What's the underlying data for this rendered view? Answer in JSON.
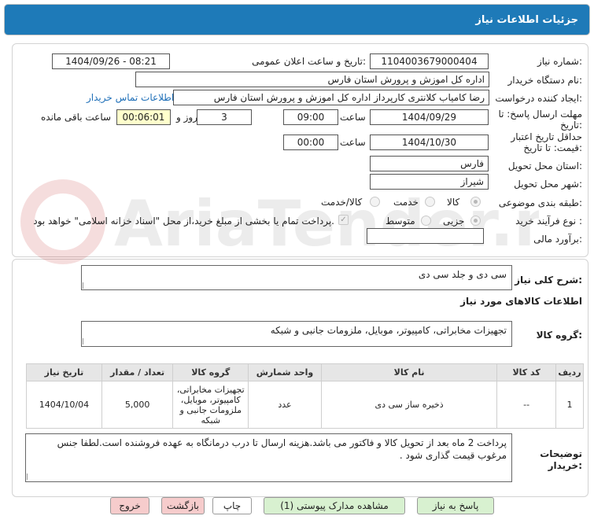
{
  "title": "جزئیات اطلاعات نیاز",
  "fields": {
    "need_number_label": "شماره نیاز:",
    "need_number": "1104003679000404",
    "announce_label": "تاریخ و ساعت اعلان عمومی:",
    "announce_value": "1404/09/26 - 08:21",
    "buyer_label": "نام دستگاه خریدار:",
    "buyer_value": "اداره کل اموزش و پرورش استان فارس",
    "creator_label": "ایجاد کننده درخواست:",
    "creator_value": "رضا کامیاب کلانتری کارپرداز اداره کل اموزش و پرورش استان فارس",
    "contact_link": "اطلاعات تماس خریدار",
    "deadline_label_1": "مهلت ارسال پاسخ: تا",
    "deadline_label_2": "تاریخ:",
    "deadline_date": "1404/09/29",
    "time_label": "ساعت",
    "deadline_time": "09:00",
    "days_value": "3",
    "days_label": "روز و",
    "remaining_value": "00:06:01",
    "remaining_label": "ساعت باقی مانده",
    "validity_label_1": "حداقل تاریخ اعتبار",
    "validity_label_2": "قیمت: تا تاریخ:",
    "validity_date": "1404/10/30",
    "validity_time": "00:00",
    "province_label": "استان محل تحویل:",
    "province_value": "فارس",
    "city_label": "شهر محل تحویل:",
    "city_value": "شیراز",
    "category_label": "طبقه بندی موضوعی:",
    "category_options": [
      "کالا",
      "خدمت",
      "کالا/خدمت"
    ],
    "process_label": "نوع فرآیند خرید :",
    "process_options": [
      "جزیی",
      "متوسط"
    ],
    "payment_note": "پرداخت تمام یا بخشی از مبلغ خرید،از محل \"اسناد خزانه اسلامی\" خواهد بود.",
    "budget_label": "برآورد مالی:"
  },
  "desc": {
    "summary_label": "شرح کلی نیاز:",
    "summary_value": "سی دی و جلد سی دی",
    "goods_info_title": "اطلاعات کالاهای مورد نیاز",
    "goods_group_label": "گروه کالا:",
    "goods_group_value": "تجهیزات مخابراتی، کامپیوتر، موبایل، ملزومات جانبی و شبکه"
  },
  "table": {
    "headers": [
      "ردیف",
      "کد کالا",
      "نام کالا",
      "واحد شمارش",
      "گروه کالا",
      "تعداد / مقدار",
      "تاریخ نیاز"
    ],
    "rows": [
      {
        "row": "1",
        "code": "--",
        "name": "ذخیره ساز سی دی",
        "unit": "عدد",
        "group": "تجهیزات مخابراتی، کامپیوتر، موبایل، ملزومات جانبی و شبکه",
        "qty": "5,000",
        "date": "1404/10/04"
      }
    ]
  },
  "notes": {
    "label_1": "توضیحات",
    "label_2": "خریدار:",
    "value": "پرداخت 2 ماه بعد از تحویل کالا و فاکتور می باشد.هزینه ارسال تا درب درمانگاه به عهده فروشنده است.لطفا جنس مرغوب قیمت گذاری شود ."
  },
  "buttons": {
    "reply": "پاسخ به نیاز",
    "view_docs": "مشاهده مدارک پیوستی (1)",
    "print": "چاپ",
    "back": "بازگشت",
    "exit": "خروج"
  },
  "colors": {
    "header_bg": "#1e7ab8",
    "green_button": "#d8f1d0",
    "red_button": "#f6cccc",
    "link": "#1e6fb8"
  }
}
